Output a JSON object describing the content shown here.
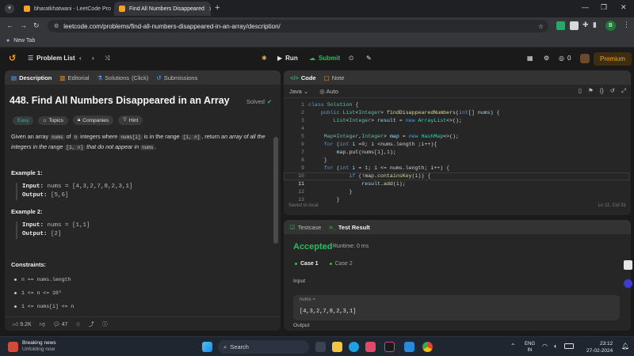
{
  "browser": {
    "tabs": [
      {
        "label": "bharatkhatwani - LeetCode Pro",
        "active": false
      },
      {
        "label": "Find All Numbers Disappeared",
        "active": true
      }
    ],
    "url": "leetcode.com/problems/find-all-numbers-disappeared-in-an-array/description/",
    "bookmark": "New Tab",
    "profile_initial": "B"
  },
  "lcnav": {
    "problem_list": "Problem List",
    "run": "Run",
    "submit": "Submit",
    "coins": "0",
    "premium": "Premium"
  },
  "left_tabs": [
    "Description",
    "Editorial",
    "Solutions",
    "(Click)",
    "Submissions"
  ],
  "problem": {
    "title": "448. Find All Numbers Disappeared in an Array",
    "solved": "Solved",
    "difficulty": "Easy",
    "chips": [
      "Topics",
      "Companies",
      "Hint"
    ],
    "para1_a": "Given an array",
    "para1_code1": "nums",
    "para1_b": "of",
    "para1_code2": "n",
    "para1_c": "integers where",
    "para1_code3": "nums[i]",
    "para1_d": "is in the range",
    "para1_code4": "[1, n]",
    "para1_e": ", return",
    "para1_em1": "an array of all the integers in the range",
    "para1_code5": "[1, n]",
    "para1_em2": "that do not appear in",
    "para1_code6": "nums",
    "para1_f": "."
  },
  "examples": [
    {
      "title": "Example 1:",
      "input_label": "Input:",
      "input": "nums = [4,3,2,7,8,2,3,1]",
      "output_label": "Output:",
      "output": "[5,6]"
    },
    {
      "title": "Example 2:",
      "input_label": "Input:",
      "input": "nums = [1,1]",
      "output_label": "Output:",
      "output": "[2]"
    }
  ],
  "constraints": {
    "title": "Constraints:",
    "items": [
      "n == nums.length",
      "1 <= n <= 10⁵",
      "1 <= nums[i] <= n"
    ]
  },
  "desc_footer": {
    "likes": "9.2K",
    "comments": "47"
  },
  "editor": {
    "tab_code": "Code",
    "tab_note": "Note",
    "language": "Java",
    "auto": "Auto",
    "saved": "Saved to local",
    "cursor": "Ln 11, Col 31",
    "line_numbers": [
      "1",
      "2",
      "3",
      "4",
      "5",
      "6",
      "7",
      "8",
      "9",
      "10",
      "11",
      "12",
      "13"
    ]
  },
  "result": {
    "tab_testcase": "Testcase",
    "tab_result": "Test Result",
    "status": "Accepted",
    "runtime": "Runtime: 0 ms",
    "cases": [
      "Case 1",
      "Case 2"
    ],
    "input_label": "Input",
    "var_label": "nums =",
    "value": "[4,3,2,7,8,2,3,1]",
    "output_label": "Output"
  },
  "taskbar": {
    "news_title": "Breaking news",
    "news_sub": "Unfolding now",
    "search": "Search",
    "lang1": "ENG",
    "lang2": "IN",
    "time": "23:12",
    "date": "27-02-2024"
  },
  "colors": {
    "accent": "#ffa116",
    "accepted": "#2cbb5d",
    "easy": "#28b8a0"
  }
}
